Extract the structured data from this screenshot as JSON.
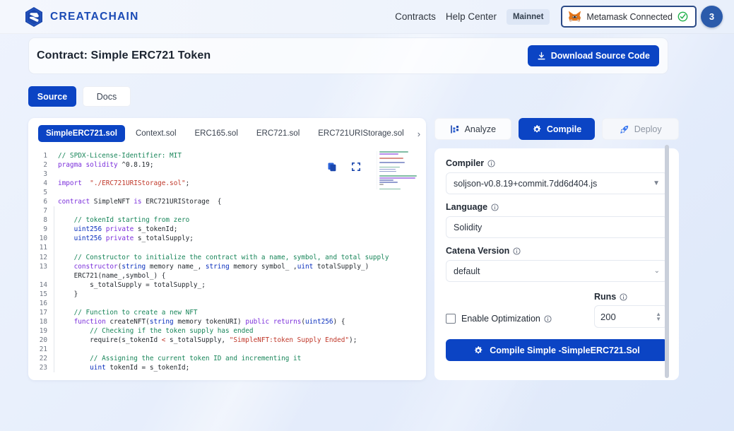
{
  "header": {
    "brand": "CREATACHAIN",
    "logo_icon": "createchain-hex-logo",
    "nav": [
      {
        "label": "Contracts",
        "name": "nav-contracts"
      },
      {
        "label": "Help Center",
        "name": "nav-help-center"
      }
    ],
    "network_chip": "Mainnet",
    "wallet": {
      "label": "Metamask Connected",
      "fox_icon": "metamask-fox-icon",
      "status_icon": "check-circle-icon",
      "status_color": "#21b24b"
    },
    "account_badge": "3",
    "accent_color": "#0b44c4"
  },
  "contract": {
    "title": "Contract: Simple ERC721 Token",
    "download_label": "Download Source Code",
    "download_icon": "download-icon"
  },
  "view_tabs": [
    {
      "label": "Source",
      "active": true
    },
    {
      "label": "Docs",
      "active": false
    }
  ],
  "editor": {
    "file_tabs": [
      {
        "label": "SimpleERC721.sol",
        "active": true
      },
      {
        "label": "Context.sol",
        "active": false
      },
      {
        "label": "ERC165.sol",
        "active": false
      },
      {
        "label": "ERC721.sol",
        "active": false
      },
      {
        "label": "ERC721URIStorage.sol",
        "active": false
      }
    ],
    "next_tab_icon": "chevron-right-icon",
    "copy_icon": "copy-icon",
    "expand_icon": "expand-icon",
    "lines": [
      {
        "n": "1",
        "indent": false,
        "tokens": [
          {
            "t": "// SPDX-License-Identifier: MIT",
            "c": "cm"
          }
        ]
      },
      {
        "n": "2",
        "indent": false,
        "tokens": [
          {
            "t": "pragma",
            "c": "kw"
          },
          {
            "t": " ",
            "c": "typ"
          },
          {
            "t": "solidity",
            "c": "kw"
          },
          {
            "t": " ^0.8.19;",
            "c": "typ"
          }
        ]
      },
      {
        "n": "3",
        "indent": false,
        "tokens": [
          {
            "t": "",
            "c": "typ"
          }
        ]
      },
      {
        "n": "4",
        "indent": false,
        "tokens": [
          {
            "t": "import",
            "c": "kw"
          },
          {
            "t": "  ",
            "c": "typ"
          },
          {
            "t": "\"./ERC721URIStorage.sol\"",
            "c": "str"
          },
          {
            "t": ";",
            "c": "typ"
          }
        ]
      },
      {
        "n": "5",
        "indent": false,
        "tokens": [
          {
            "t": "",
            "c": "typ"
          }
        ]
      },
      {
        "n": "6",
        "indent": false,
        "tokens": [
          {
            "t": "contract",
            "c": "kw"
          },
          {
            "t": " SimpleNFT ",
            "c": "typ"
          },
          {
            "t": "is",
            "c": "kw"
          },
          {
            "t": " ERC721URIStorage  {",
            "c": "typ"
          }
        ]
      },
      {
        "n": "7",
        "indent": true,
        "tokens": [
          {
            "t": "",
            "c": "typ"
          }
        ]
      },
      {
        "n": "8",
        "indent": true,
        "tokens": [
          {
            "t": "    // tokenId starting from zero",
            "c": "cm"
          }
        ]
      },
      {
        "n": "9",
        "indent": true,
        "tokens": [
          {
            "t": "    ",
            "c": "typ"
          },
          {
            "t": "uint256",
            "c": "kw2"
          },
          {
            "t": " ",
            "c": "typ"
          },
          {
            "t": "private",
            "c": "kw"
          },
          {
            "t": " s_tokenId;",
            "c": "typ"
          }
        ]
      },
      {
        "n": "10",
        "indent": true,
        "tokens": [
          {
            "t": "    ",
            "c": "typ"
          },
          {
            "t": "uint256",
            "c": "kw2"
          },
          {
            "t": " ",
            "c": "typ"
          },
          {
            "t": "private",
            "c": "kw"
          },
          {
            "t": " s_totalSupply;",
            "c": "typ"
          }
        ]
      },
      {
        "n": "11",
        "indent": true,
        "tokens": [
          {
            "t": "",
            "c": "typ"
          }
        ]
      },
      {
        "n": "12",
        "indent": true,
        "tokens": [
          {
            "t": "    // Constructor to initialize the contract with a name, symbol, and total supply",
            "c": "cm"
          }
        ]
      },
      {
        "n": "13",
        "indent": true,
        "tokens": [
          {
            "t": "    ",
            "c": "typ"
          },
          {
            "t": "constructor",
            "c": "kw"
          },
          {
            "t": "(",
            "c": "typ"
          },
          {
            "t": "string",
            "c": "kw2"
          },
          {
            "t": " memory name_, ",
            "c": "typ"
          },
          {
            "t": "string",
            "c": "kw2"
          },
          {
            "t": " memory symbol_ ,",
            "c": "typ"
          },
          {
            "t": "uint",
            "c": "kw2"
          },
          {
            "t": " totalSupply_)",
            "c": "typ"
          }
        ]
      },
      {
        "n": "",
        "indent": true,
        "tokens": [
          {
            "t": "    ERC721(name_,symbol_) {",
            "c": "typ"
          }
        ]
      },
      {
        "n": "14",
        "indent": true,
        "tokens": [
          {
            "t": "        s_totalSupply = totalSupply_;",
            "c": "typ"
          }
        ]
      },
      {
        "n": "15",
        "indent": true,
        "tokens": [
          {
            "t": "    }",
            "c": "typ"
          }
        ]
      },
      {
        "n": "16",
        "indent": true,
        "tokens": [
          {
            "t": "",
            "c": "typ"
          }
        ]
      },
      {
        "n": "17",
        "indent": true,
        "tokens": [
          {
            "t": "    // Function to create a new NFT",
            "c": "cm"
          }
        ]
      },
      {
        "n": "18",
        "indent": true,
        "tokens": [
          {
            "t": "    ",
            "c": "typ"
          },
          {
            "t": "function",
            "c": "kw"
          },
          {
            "t": " createNFT(",
            "c": "typ"
          },
          {
            "t": "string",
            "c": "kw2"
          },
          {
            "t": " memory tokenURI) ",
            "c": "typ"
          },
          {
            "t": "public",
            "c": "kw"
          },
          {
            "t": " ",
            "c": "typ"
          },
          {
            "t": "returns",
            "c": "kw"
          },
          {
            "t": "(",
            "c": "typ"
          },
          {
            "t": "uint256",
            "c": "kw2"
          },
          {
            "t": ") {",
            "c": "typ"
          }
        ]
      },
      {
        "n": "19",
        "indent": true,
        "tokens": [
          {
            "t": "        // Checking if the token supply has ended",
            "c": "cm"
          }
        ]
      },
      {
        "n": "20",
        "indent": true,
        "tokens": [
          {
            "t": "        require(s_tokenId ",
            "c": "typ"
          },
          {
            "t": "<",
            "c": "op"
          },
          {
            "t": " s_totalSupply, ",
            "c": "typ"
          },
          {
            "t": "\"SimpleNFT:token Supply Ended\"",
            "c": "str"
          },
          {
            "t": ");",
            "c": "typ"
          }
        ]
      },
      {
        "n": "21",
        "indent": true,
        "tokens": [
          {
            "t": "",
            "c": "typ"
          }
        ]
      },
      {
        "n": "22",
        "indent": true,
        "tokens": [
          {
            "t": "        // Assigning the current token ID and incrementing it",
            "c": "cm"
          }
        ]
      },
      {
        "n": "23",
        "indent": true,
        "tokens": [
          {
            "t": "        ",
            "c": "typ"
          },
          {
            "t": "uint",
            "c": "kw2"
          },
          {
            "t": " tokenId = s_tokenId;",
            "c": "typ"
          }
        ]
      }
    ]
  },
  "right_panel": {
    "mode_tabs": [
      {
        "label": "Analyze",
        "icon": "analyze-icon",
        "state": "idle"
      },
      {
        "label": "Compile",
        "icon": "gear-icon",
        "state": "active"
      },
      {
        "label": "Deploy",
        "icon": "rocket-icon",
        "state": "disabled"
      }
    ],
    "fields": [
      {
        "label": "Compiler",
        "value": "soljson-v0.8.19+commit.7dd6d404.js",
        "control": "select",
        "info_icon": "info-icon"
      },
      {
        "label": "Language",
        "value": "Solidity",
        "control": "input",
        "info_icon": "info-icon"
      },
      {
        "label": "Catena Version",
        "value": "default",
        "control": "select",
        "info_icon": "info-icon"
      }
    ],
    "optimization": {
      "label": "Enable Optimization",
      "checked": false,
      "info_icon": "info-icon"
    },
    "runs": {
      "label": "Runs",
      "value": "200",
      "info_icon": "info-icon"
    },
    "compile_button": {
      "label": "Compile Simple -SimpleERC721.Sol",
      "icon": "gear-icon"
    }
  }
}
